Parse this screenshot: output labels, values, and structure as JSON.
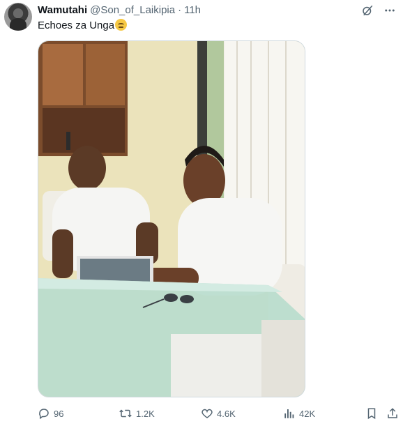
{
  "tweet": {
    "author_name": "Wamutahi",
    "author_handle": "@Son_of_Laikipia",
    "separator": "·",
    "time": "11h",
    "text": "Echoes za Unga",
    "emoji": "relieved-face",
    "avatar_icon": "user-avatar",
    "media_description_icon": "photo"
  },
  "actions": {
    "replies": "96",
    "retweets": "1.2K",
    "likes": "4.6K",
    "views": "42K"
  },
  "icons": {
    "grok": "grok-slash-circle-icon",
    "more": "more-dots-icon",
    "reply": "reply-bubble-icon",
    "retweet": "retweet-icon",
    "like": "heart-icon",
    "views": "views-bars-icon",
    "bookmark": "bookmark-icon",
    "share": "share-icon"
  },
  "colors": {
    "text": "#0f1419",
    "secondary": "#536471",
    "border": "#cfd9de"
  }
}
